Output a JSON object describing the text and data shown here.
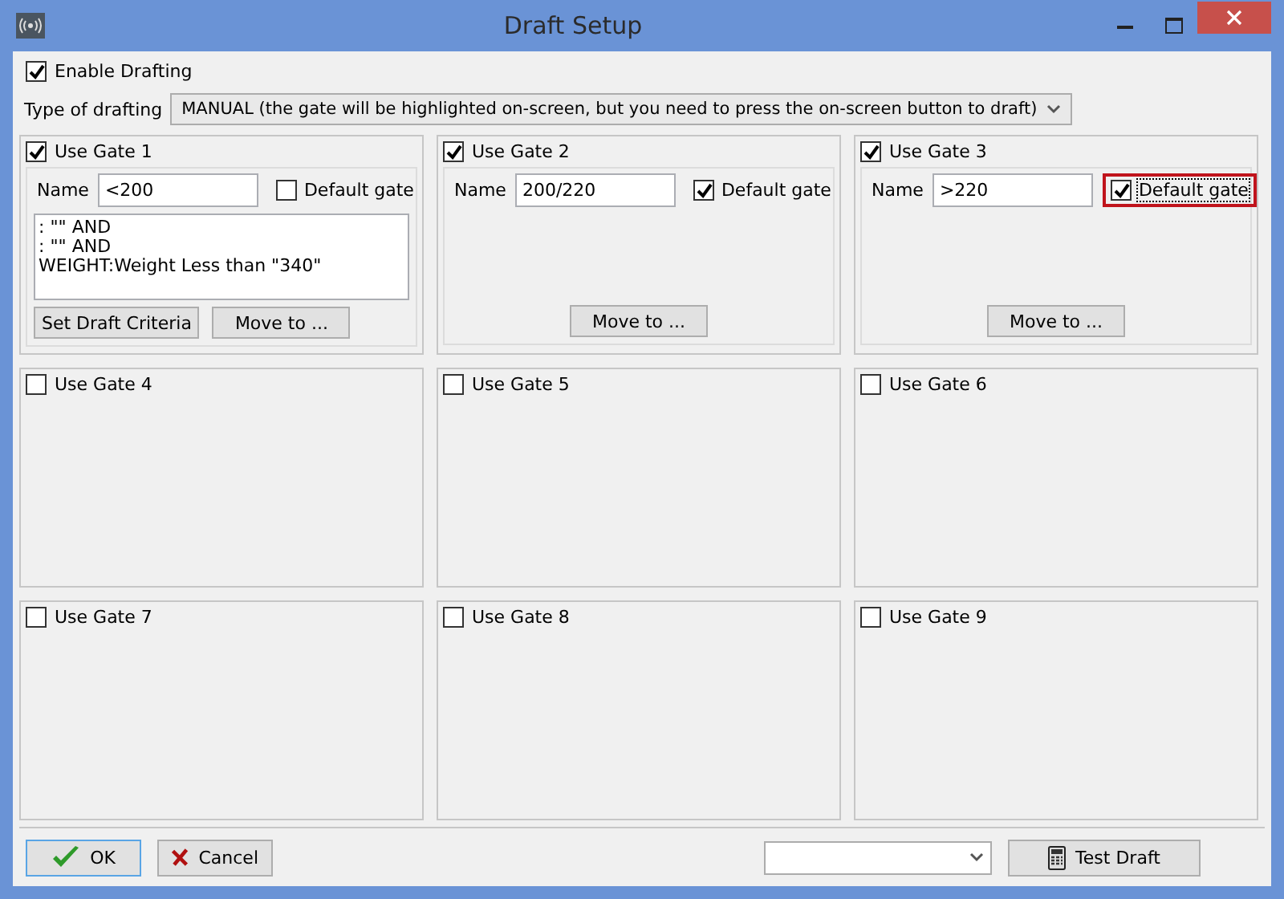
{
  "window": {
    "title": "Draft Setup"
  },
  "enable_drafting": {
    "label": "Enable Drafting",
    "checked": true
  },
  "type_of_drafting": {
    "label": "Type of drafting",
    "value": "MANUAL (the gate will be highlighted on-screen, but you need to press the on-screen button to draft)"
  },
  "gates": [
    {
      "label": "Use Gate 1",
      "checked": true,
      "name_label": "Name",
      "name": "<200",
      "default_label": "Default gate",
      "default": false,
      "highlighted": false,
      "criteria": [
        ": \"\" AND",
        ": \"\" AND",
        "WEIGHT:Weight Less than \"340\""
      ],
      "buttons": [
        "Set Draft Criteria",
        "Move to ..."
      ]
    },
    {
      "label": "Use Gate 2",
      "checked": true,
      "name_label": "Name",
      "name": "200/220",
      "default_label": "Default gate",
      "default": true,
      "highlighted": false,
      "buttons": [
        "Move to ..."
      ]
    },
    {
      "label": "Use Gate 3",
      "checked": true,
      "name_label": "Name",
      "name": ">220",
      "default_label": "Default gate",
      "default": true,
      "highlighted": true,
      "buttons": [
        "Move to ..."
      ]
    },
    {
      "label": "Use Gate 4",
      "checked": false
    },
    {
      "label": "Use Gate 5",
      "checked": false
    },
    {
      "label": "Use Gate 6",
      "checked": false
    },
    {
      "label": "Use Gate 7",
      "checked": false
    },
    {
      "label": "Use Gate 8",
      "checked": false
    },
    {
      "label": "Use Gate 9",
      "checked": false
    }
  ],
  "footer": {
    "ok": "OK",
    "cancel": "Cancel",
    "test": "Test Draft"
  }
}
